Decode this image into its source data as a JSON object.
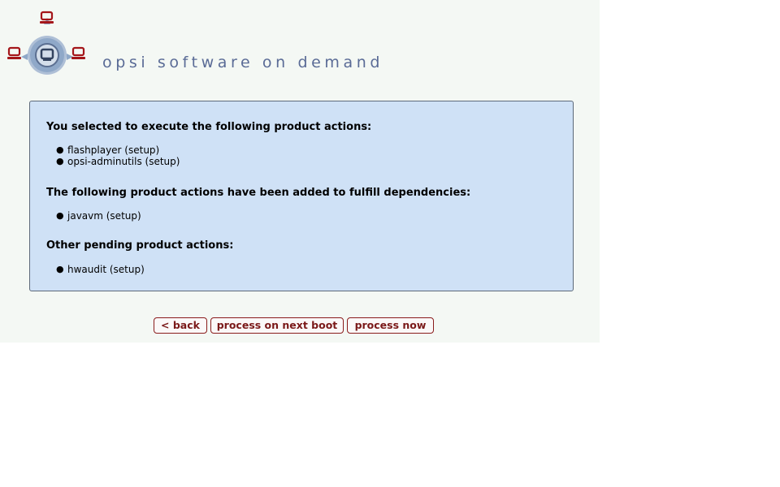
{
  "header": {
    "brand_text": "opsi software on demand"
  },
  "panel": {
    "selected_title": "You selected to execute the following product actions:",
    "selected_items": [
      "flashplayer (setup)",
      "opsi-adminutils (setup)"
    ],
    "dependencies_title": "The following product actions have been added to fulfill dependencies:",
    "dependency_items": [
      "javavm (setup)"
    ],
    "pending_title": "Other pending product actions:",
    "pending_items": [
      "hwaudit (setup)"
    ]
  },
  "buttons": {
    "back": "< back",
    "next_boot": "process on next boot",
    "now": "process now"
  },
  "colors": {
    "brand": "#5a6b96",
    "panel_background": "#cfe1f6",
    "button_text": "#7a1818",
    "logo_red": "#a4161a",
    "logo_blue": "#8fa8c8"
  },
  "icons": {
    "logo": "opsi-network-logo-icon"
  }
}
